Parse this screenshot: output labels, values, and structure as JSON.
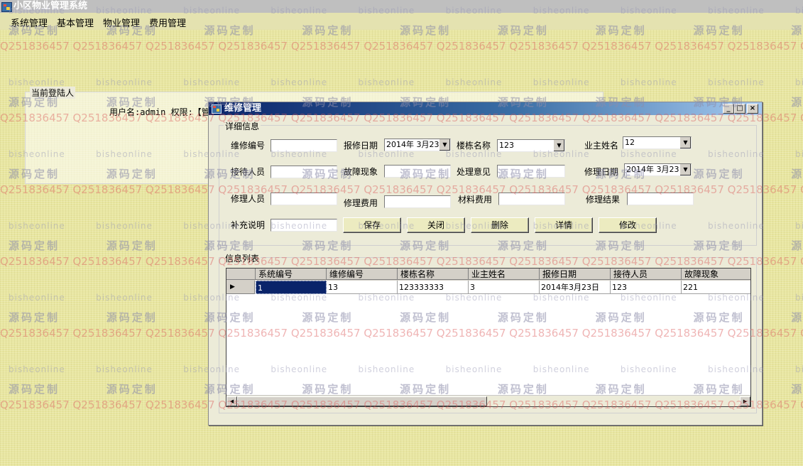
{
  "app": {
    "title": "小区物业管理系统"
  },
  "menu": {
    "items": [
      "系统管理",
      "基本管理",
      "物业管理",
      "费用管理"
    ]
  },
  "login_panel": {
    "title": "当前登陆人",
    "user_text": "用户名:admin 权限:【管理"
  },
  "child_window": {
    "title": "维修管理",
    "controls": [
      "_",
      "□",
      "×"
    ],
    "detail_group": {
      "title": "详细信息",
      "fields": {
        "repair_no": {
          "label": "维修编号",
          "value": ""
        },
        "report_date": {
          "label": "报修日期",
          "value": "2014年 3月23日"
        },
        "building": {
          "label": "楼栋名称",
          "value": "123"
        },
        "owner": {
          "label": "业主姓名",
          "value": "12"
        },
        "receiver": {
          "label": "接待人员",
          "value": ""
        },
        "fault": {
          "label": "故障现象",
          "value": ""
        },
        "opinion": {
          "label": "处理意见",
          "value": ""
        },
        "repair_date": {
          "label": "修理日期",
          "value": "2014年 3月23日"
        },
        "repairer": {
          "label": "修理人员",
          "value": ""
        },
        "repair_fee": {
          "label": "修理费用",
          "value": ""
        },
        "material_fee": {
          "label": "材料费用",
          "value": ""
        },
        "result": {
          "label": "修理结果",
          "value": ""
        },
        "note": {
          "label": "补充说明",
          "value": ""
        }
      },
      "buttons": [
        "保存",
        "关闭",
        "删除",
        "详情",
        "修改"
      ]
    },
    "list_group": {
      "title": "信息列表",
      "columns": [
        "系统编号",
        "维修编号",
        "楼栋名称",
        "业主姓名",
        "报修日期",
        "接待人员",
        "故障现象"
      ],
      "rows": [
        [
          "1",
          "13",
          "123333333",
          "3",
          "2014年3月23日",
          "123",
          "221"
        ]
      ],
      "row_indicator": "▶"
    }
  },
  "watermark": {
    "line_a": "bisheonline",
    "line_b": "源码定制",
    "line_c": "Q251836457"
  },
  "colors": {
    "background": "#e8e6a0",
    "title_gradient_start": "#0a246a",
    "title_gradient_end": "#a6caf0",
    "selection": "#0a246a"
  }
}
